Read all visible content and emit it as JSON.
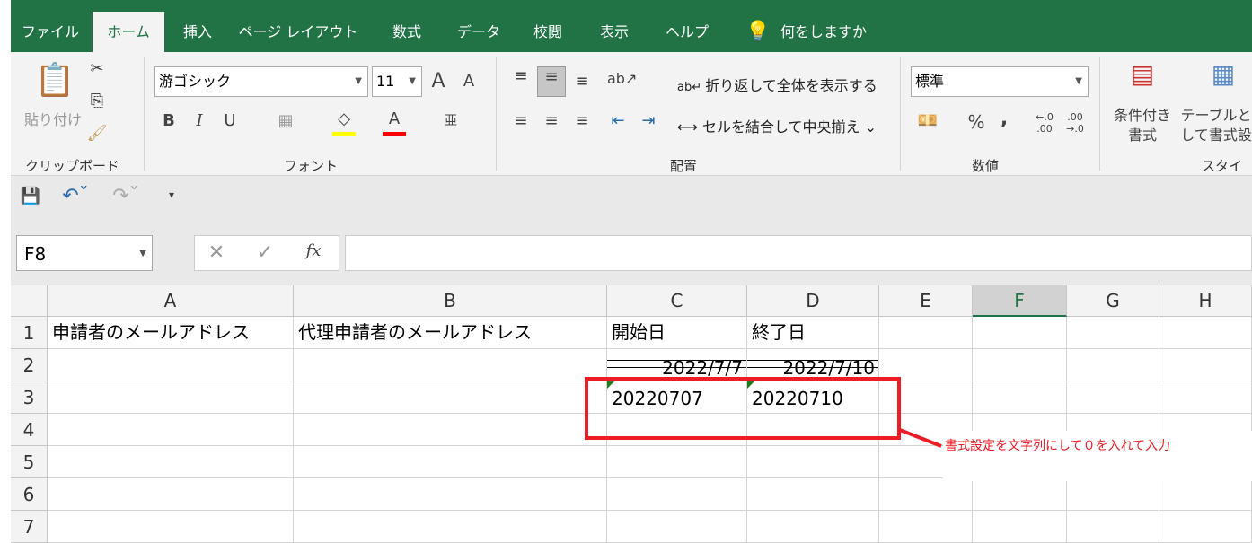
{
  "tabs": [
    "ファイル",
    "ホーム",
    "挿入",
    "ページ レイアウト",
    "数式",
    "データ",
    "校閲",
    "表示",
    "ヘルプ"
  ],
  "tell_me": "何をしますか",
  "ribbon": {
    "clipboard": {
      "paste": "貼り付け",
      "label": "クリップボード"
    },
    "font": {
      "name": "游ゴシック",
      "size": "11",
      "label": "フォント",
      "bold": "B",
      "italic": "I",
      "underline": "U",
      "fill_color": "#ffff00",
      "font_color": "#ff0000"
    },
    "alignment": {
      "wrap": "折り返して全体を表示する",
      "merge": "セルを結合して中央揃え",
      "label": "配置"
    },
    "number": {
      "format": "標準",
      "label": "数値",
      "percent": "%",
      "comma": ","
    },
    "styles": {
      "conditional": "条件付き書式",
      "table": "テーブルとして書式設定",
      "label": "スタイル"
    }
  },
  "formula_bar": {
    "name_box": "F8",
    "formula": ""
  },
  "columns": [
    "A",
    "B",
    "C",
    "D",
    "E",
    "F",
    "G",
    "H"
  ],
  "rows": [
    "1",
    "2",
    "3",
    "4",
    "5",
    "6",
    "7"
  ],
  "cells": {
    "A1": "申請者のメールアドレス",
    "B1": "代理申請者のメールアドレス",
    "C1": "開始日",
    "D1": "終了日",
    "C2": "2022/7/7",
    "D2": "2022/7/10",
    "C3": "20220707",
    "D3": "20220710"
  },
  "annotation": {
    "text": "書式設定を文字列にして０を入れて入力",
    "color": "#ee1c25"
  }
}
